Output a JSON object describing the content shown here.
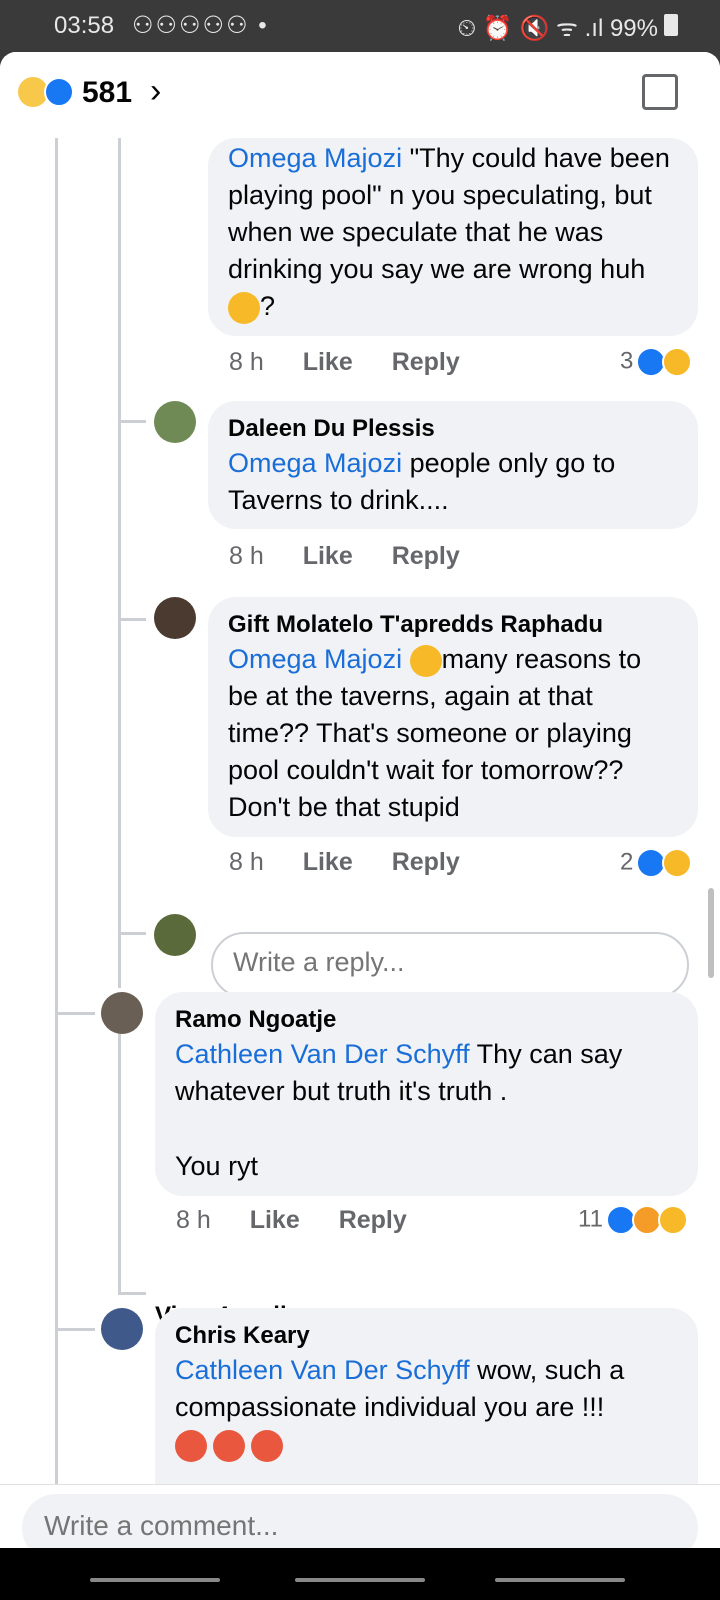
{
  "status": {
    "time": "03:58",
    "icons": "⚇⚇⚇⚇⚇ •",
    "right": "⏲ ⏰ 🔇 ᯤ .ıl 99%"
  },
  "header": {
    "reaction_count": "581",
    "chevron": "›"
  },
  "comments": [
    {
      "name": "",
      "mention": "Omega Majozi",
      "text": " \"Thy could have been playing pool\" n you speculating, but when we speculate that he was drinking you say we are wrong huh ",
      "tail": "?",
      "time": "8 h",
      "like": "Like",
      "reply": "Reply",
      "reactions": "3"
    },
    {
      "name": "Daleen Du Plessis",
      "mention": "Omega Majozi",
      "text": " people only go to Taverns to drink....",
      "time": "8 h",
      "like": "Like",
      "reply": "Reply"
    },
    {
      "name": "Gift Molatelo T'apredds Raphadu",
      "mention": "Omega Majozi",
      "text": "many reasons to be at the taverns, again at that time?? That's someone or playing pool couldn't wait for tomorrow?? Don't be that stupid",
      "time": "8 h",
      "like": "Like",
      "reply": "Reply",
      "reactions": "2"
    },
    {
      "name": "Ramo Ngoatje",
      "mention": "Cathleen Van Der Schyff",
      "text": " Thy can say whatever but truth it's truth .",
      "text2": "You ryt",
      "time": "8 h",
      "like": "Like",
      "reply": "Reply",
      "reactions": "11"
    },
    {
      "name": "Chris Keary",
      "mention": "Cathleen Van Der Schyff",
      "text": " wow, such a compassionate individual you are !!!"
    }
  ],
  "reply_input": {
    "placeholder": "Write a reply..."
  },
  "view_replies": "View 4 replies...",
  "comment_input": {
    "placeholder": "Write a comment..."
  },
  "colors": {
    "mention": "#1a6ed8",
    "bubble": "#f0f2f5",
    "like_blue": "#1877f2"
  }
}
